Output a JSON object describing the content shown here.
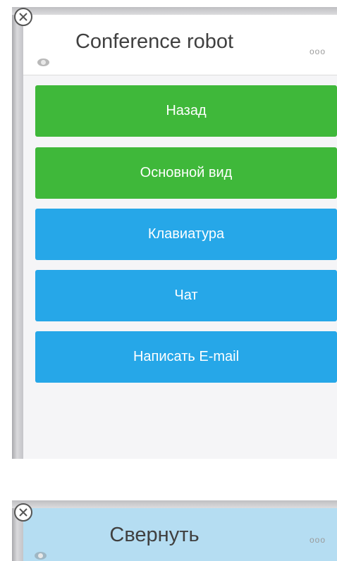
{
  "top_widget": {
    "title": "Conference robot",
    "menu_glyph": "ooo",
    "buttons": [
      {
        "label": "Назад",
        "color": "#3fb83a"
      },
      {
        "label": "Основной вид",
        "color": "#3fb83a"
      },
      {
        "label": "Клавиатура",
        "color": "#26a7e8"
      },
      {
        "label": "Чат",
        "color": "#26a7e8"
      },
      {
        "label": "Написать E-mail",
        "color": "#26a7e8"
      }
    ]
  },
  "bottom_widget": {
    "title": "Свернуть",
    "menu_glyph": "ooo",
    "background": "#b5ddf2"
  },
  "icons": [
    "close-icon",
    "eye-icon",
    "more-options-icon"
  ]
}
